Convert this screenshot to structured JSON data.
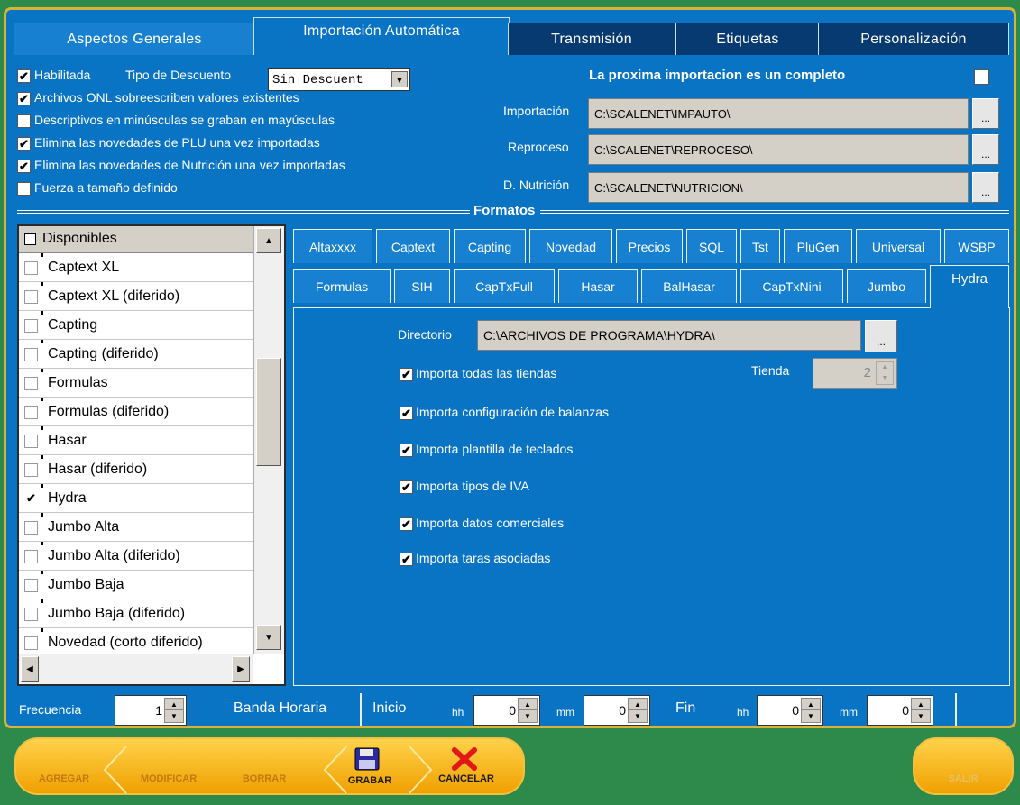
{
  "top_tabs": [
    "Aspectos Generales",
    "Importación Automática",
    "Transmisión",
    "Etiquetas",
    "Personalización"
  ],
  "general": {
    "habilitada_label": "Habilitada",
    "tipo_descuento_label": "Tipo de Descuento",
    "tipo_descuento_value": "Sin Descuent",
    "options": [
      {
        "label": "Archivos ONL sobreescriben valores existentes",
        "checked": true
      },
      {
        "label": "Descriptivos en minúsculas se graban en mayúsculas",
        "checked": false
      },
      {
        "label": "Elimina las novedades de PLU una vez importadas",
        "checked": true
      },
      {
        "label": "Elimina las novedades de Nutrición una vez importadas",
        "checked": true
      },
      {
        "label": "Fuerza a tamaño definido",
        "checked": false
      }
    ],
    "proxima_label": "La proxima importacion es un completo"
  },
  "paths": {
    "importacion_label": "Importación",
    "importacion_value": "C:\\SCALENET\\IMPAUTO\\",
    "reproceso_label": "Reproceso",
    "reproceso_value": "C:\\SCALENET\\REPROCESO\\",
    "nutricion_label": "D. Nutrición",
    "nutricion_value": "C:\\SCALENET\\NUTRICION\\",
    "browse_label": "..."
  },
  "formatos_label": "Formatos",
  "list": {
    "header": "Disponibles",
    "items": [
      {
        "label": "Captext XL",
        "checked": false
      },
      {
        "label": "Captext XL (diferido)",
        "checked": false
      },
      {
        "label": "Capting",
        "checked": false
      },
      {
        "label": "Capting (diferido)",
        "checked": false
      },
      {
        "label": "Formulas",
        "checked": false
      },
      {
        "label": "Formulas (diferido)",
        "checked": false
      },
      {
        "label": "Hasar",
        "checked": false
      },
      {
        "label": "Hasar (diferido)",
        "checked": false
      },
      {
        "label": "Hydra",
        "checked": true
      },
      {
        "label": "Jumbo Alta",
        "checked": false
      },
      {
        "label": "Jumbo Alta (diferido)",
        "checked": false
      },
      {
        "label": "Jumbo Baja",
        "checked": false
      },
      {
        "label": "Jumbo Baja (diferido)",
        "checked": false
      },
      {
        "label": "Novedad (corto diferido)",
        "checked": false
      }
    ]
  },
  "format_tabs_row1": [
    "Altaxxxx",
    "Captext",
    "Capting",
    "Novedad",
    "Precios",
    "SQL",
    "Tst",
    "PluGen",
    "Universal",
    "WSBP"
  ],
  "format_tabs_row2": [
    "Formulas",
    "SIH",
    "CapTxFull",
    "Hasar",
    "BalHasar",
    "CapTxNini",
    "Jumbo",
    "Hydra"
  ],
  "hydra": {
    "directorio_label": "Directorio",
    "directorio_value": "C:\\ARCHIVOS DE PROGRAMA\\HYDRA\\",
    "tienda_label": "Tienda",
    "tienda_value": "2",
    "options": [
      {
        "label": "Importa todas las tiendas",
        "checked": true
      },
      {
        "label": "Importa configuración de balanzas",
        "checked": true
      },
      {
        "label": "Importa plantilla de teclados",
        "checked": true
      },
      {
        "label": "Importa tipos de IVA",
        "checked": true
      },
      {
        "label": "Importa datos comerciales",
        "checked": true
      },
      {
        "label": "Importa taras asociadas",
        "checked": true
      }
    ]
  },
  "bottom": {
    "frecuencia_label": "Frecuencia",
    "frecuencia_value": "1",
    "banda_label": "Banda Horaria",
    "inicio_label": "Inicio",
    "fin_label": "Fin",
    "hh_label": "hh",
    "mm_label": "mm",
    "inicio_hh": "0",
    "inicio_mm": "0",
    "fin_hh": "0",
    "fin_mm": "0"
  },
  "actions": {
    "agregar": "AGREGAR",
    "modificar": "MODIFICAR",
    "borrar": "BORRAR",
    "grabar": "GRABAR",
    "cancelar": "CANCELAR",
    "salir": "SALIR"
  }
}
